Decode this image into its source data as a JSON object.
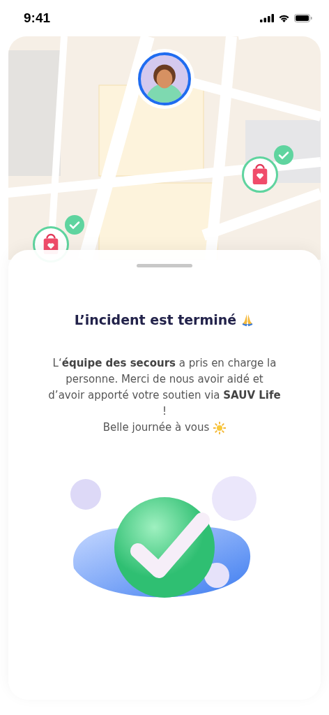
{
  "status_bar": {
    "time": "9:41"
  },
  "map": {
    "markers": [
      {
        "kind": "user"
      },
      {
        "kind": "defibrillator",
        "checked": true
      },
      {
        "kind": "defibrillator",
        "checked": true
      }
    ]
  },
  "sheet": {
    "title": "L’incident est terminé",
    "message": "L‘**équipe des secours** a pris en charge la personne. Merci de nous avoir aidé et d’avoir apporté votre soutien via **SAUV Life** !",
    "closing": "Belle journée à vous"
  }
}
